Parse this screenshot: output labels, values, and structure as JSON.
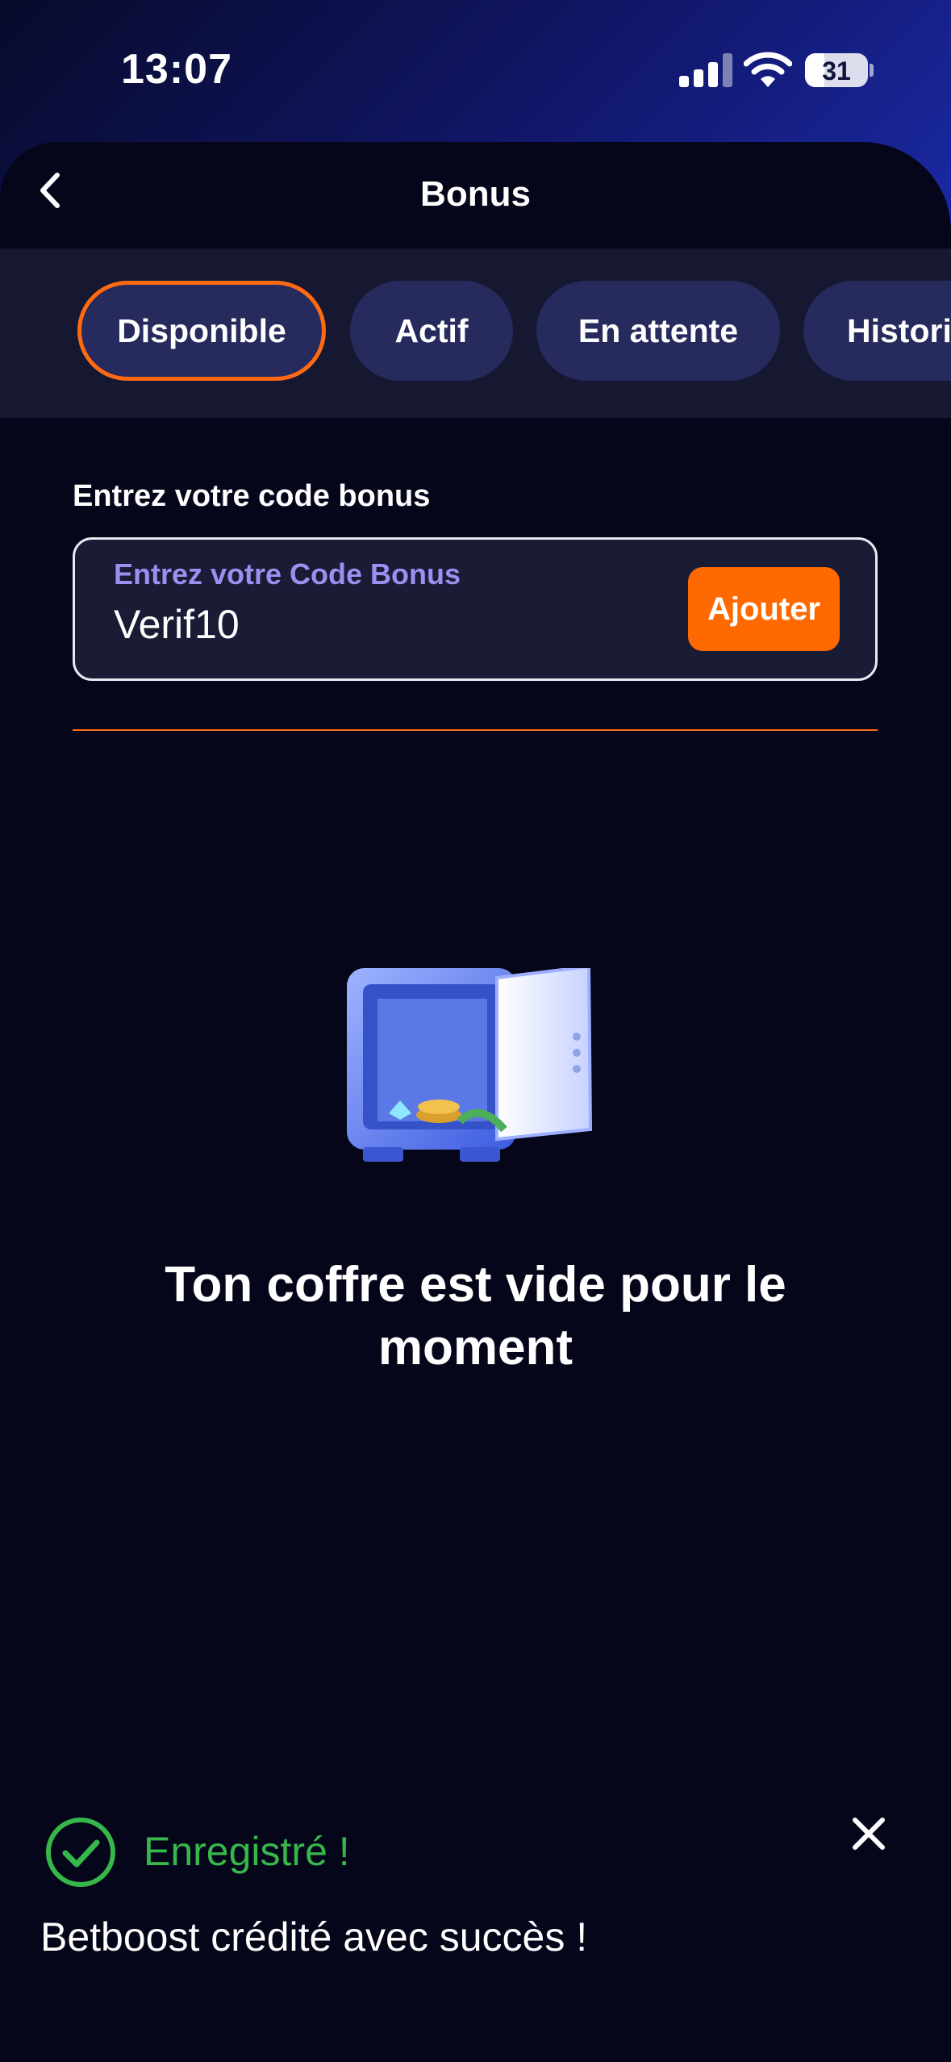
{
  "status_bar": {
    "time": "13:07",
    "battery": "31"
  },
  "header": {
    "title": "Bonus",
    "back_icon": "chevron-left-icon"
  },
  "tabs": [
    {
      "label": "Disponible",
      "active": true
    },
    {
      "label": "Actif",
      "active": false
    },
    {
      "label": "En attente",
      "active": false
    },
    {
      "label": "Historique",
      "active": false
    }
  ],
  "bonus_code": {
    "section_label": "Entrez votre code bonus",
    "field_label": "Entrez votre Code Bonus",
    "value": "Verif10",
    "add_label": "Ajouter"
  },
  "empty_state": {
    "icon": "open-safe-illustration",
    "message": "Ton coffre est vide pour le moment"
  },
  "toast": {
    "title": "Enregistré !",
    "message": "Betboost crédité avec succès !",
    "status_icon": "check-circle-icon",
    "close_icon": "close-icon"
  },
  "colors": {
    "accent": "#ff6a00",
    "success": "#37b64b",
    "background": "#05061a",
    "tab_bg": "#262a5c"
  }
}
